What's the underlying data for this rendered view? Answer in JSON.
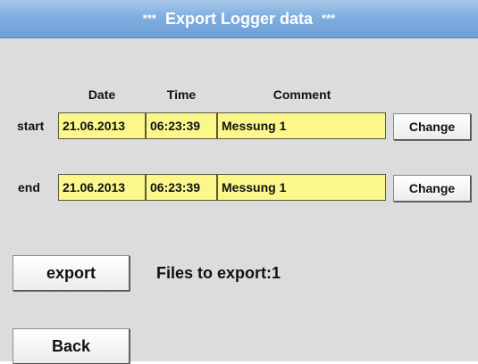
{
  "window": {
    "title_stars_left": "***",
    "title": "Export Logger data",
    "title_stars_right": "***"
  },
  "columns": {
    "date": "Date",
    "time": "Time",
    "comment": "Comment"
  },
  "start": {
    "label": "start",
    "date": "21.06.2013",
    "time": "06:23:39",
    "comment": "Messung 1",
    "change_label": "Change"
  },
  "end": {
    "label": "end",
    "date": "21.06.2013",
    "time": "06:23:39",
    "comment": "Messung 1",
    "change_label": "Change"
  },
  "actions": {
    "export_label": "export",
    "files_to_export": "Files to export:1",
    "back_label": "Back"
  },
  "colors": {
    "title_bar": "#7eaee0",
    "field_background": "#fbf78a",
    "screen_background": "#dcdcdc"
  }
}
